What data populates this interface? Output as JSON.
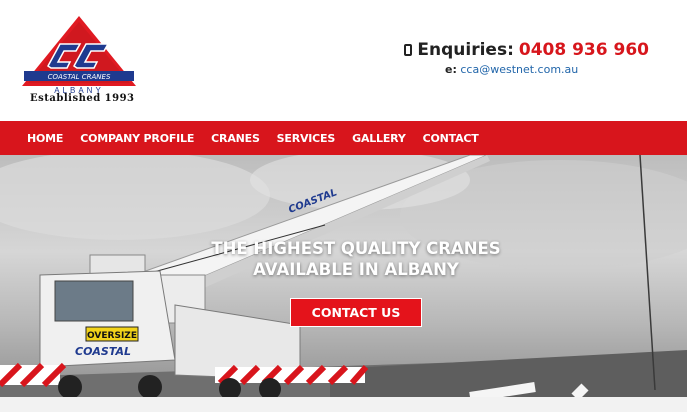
{
  "brand": {
    "logo_text": "CC",
    "logo_banner": "COASTAL CRANES",
    "logo_location": "ALBANY",
    "tagline": "Established 1993"
  },
  "contact": {
    "enquiries_label": "Enquiries:",
    "phone": "0408 936 960",
    "email_label": "e:",
    "email": "cca@westnet.com.au"
  },
  "nav": {
    "items": [
      {
        "label": "HOME"
      },
      {
        "label": "COMPANY PROFILE"
      },
      {
        "label": "CRANES"
      },
      {
        "label": "SERVICES"
      },
      {
        "label": "GALLERY"
      },
      {
        "label": "CONTACT"
      }
    ]
  },
  "hero": {
    "title_line1": "THE HIGHEST QUALITY CRANES",
    "title_line2": "AVAILABLE IN ALBANY",
    "cta_label": "CONTACT US",
    "crane_boom_text": "COASTAL",
    "oversize_sign": "OVERSIZE",
    "truck_side_text": "COASTAL"
  },
  "colors": {
    "brand_red": "#d8151c",
    "brand_blue": "#1f3a8f"
  }
}
